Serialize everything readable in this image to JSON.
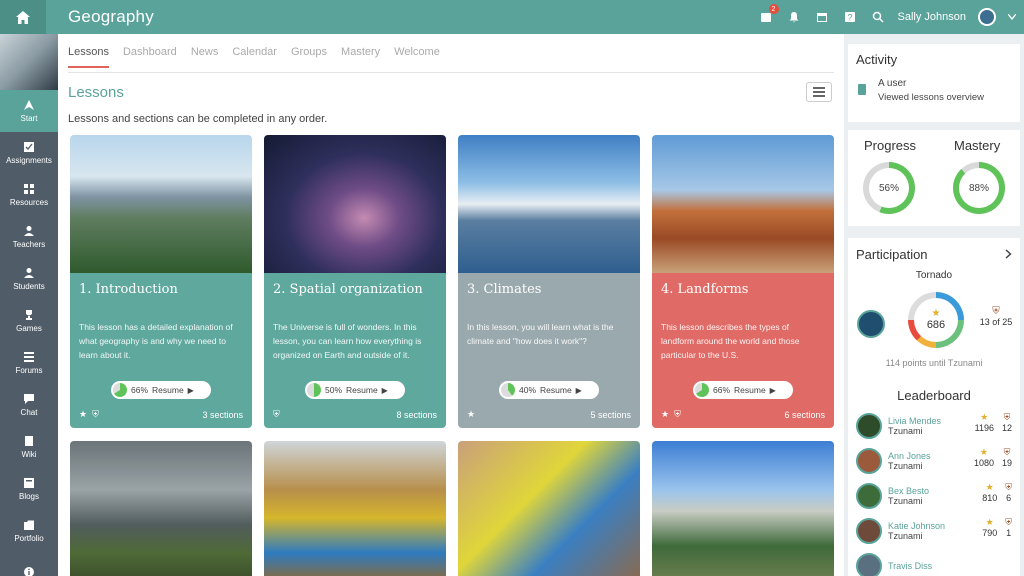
{
  "header": {
    "title": "Geography",
    "user_name": "Sally Johnson",
    "notification_count": "2"
  },
  "sidebar": {
    "items": [
      {
        "label": "Start",
        "icon": "navigation-icon"
      },
      {
        "label": "Assignments",
        "icon": "assignment-icon"
      },
      {
        "label": "Resources",
        "icon": "resources-icon"
      },
      {
        "label": "Teachers",
        "icon": "teacher-icon"
      },
      {
        "label": "Students",
        "icon": "student-icon"
      },
      {
        "label": "Games",
        "icon": "trophy-icon"
      },
      {
        "label": "Forums",
        "icon": "forum-icon"
      },
      {
        "label": "Chat",
        "icon": "chat-icon"
      },
      {
        "label": "Wiki",
        "icon": "wiki-icon"
      },
      {
        "label": "Blogs",
        "icon": "blog-icon"
      },
      {
        "label": "Portfolio",
        "icon": "portfolio-icon"
      }
    ]
  },
  "tabs": [
    "Lessons",
    "Dashboard",
    "News",
    "Calendar",
    "Groups",
    "Mastery",
    "Welcome"
  ],
  "main": {
    "section_title": "Lessons",
    "subtitle": "Lessons and sections can be completed in any order."
  },
  "cards": [
    {
      "title": "1. Introduction",
      "desc": "This lesson has a detailed explanation of what geography is and why we need to learn about it.",
      "progress": "66%",
      "progress_value": 0.66,
      "resume": "Resume",
      "sections": "3 sections",
      "color": "#5fa89e"
    },
    {
      "title": "2. Spatial organization",
      "desc": "The Universe is full of wonders. In this lesson, you can learn how everything is organized on Earth and outside of it.",
      "progress": "50%",
      "progress_value": 0.5,
      "resume": "Resume",
      "sections": "8 sections",
      "color": "#5fa89e"
    },
    {
      "title": "3. Climates",
      "desc": "In this lesson, you will learn what is the climate and \"how does it work\"?",
      "progress": "40%",
      "progress_value": 0.4,
      "resume": "Resume",
      "sections": "5 sections",
      "color": "#9aa9ad"
    },
    {
      "title": "4. Landforms",
      "desc": "This lesson describes the types of landform around the world and those particular to the U.S.",
      "progress": "66%",
      "progress_value": 0.66,
      "resume": "Resume",
      "sections": "6 sections",
      "color": "#e06b66"
    }
  ],
  "activity": {
    "title": "Activity",
    "line1": "A user",
    "line2": "Viewed lessons overview"
  },
  "progress": {
    "progress_label": "Progress",
    "progress_value": "56%",
    "progress_fraction": 0.56,
    "mastery_label": "Mastery",
    "mastery_value": "88%",
    "mastery_fraction": 0.88
  },
  "participation": {
    "title": "Participation",
    "team": "Tornado",
    "score": "686",
    "rank": "13 of 25",
    "points_note": "114 points until Tzunami"
  },
  "leaderboard": {
    "title": "Leaderboard",
    "rows": [
      {
        "name": "Livia Mendes",
        "team": "Tzunami",
        "points": "1196",
        "badges": "12"
      },
      {
        "name": "Ann Jones",
        "team": "Tzunami",
        "points": "1080",
        "badges": "19"
      },
      {
        "name": "Bex Besto",
        "team": "Tzunami",
        "points": "810",
        "badges": "6"
      },
      {
        "name": "Katie Johnson",
        "team": "Tzunami",
        "points": "790",
        "badges": "1"
      },
      {
        "name": "Travis Diss",
        "team": "",
        "points": "",
        "badges": ""
      }
    ]
  },
  "colors": {
    "accent": "#5aa39a",
    "sidebar": "#505d68",
    "red": "#e0645a",
    "mastery_green": "#5fc35a"
  }
}
